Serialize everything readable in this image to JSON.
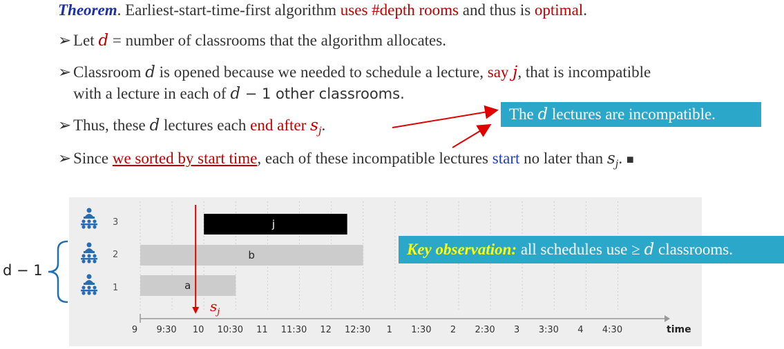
{
  "theorem": {
    "label": "Theorem",
    "text_1": ". Earliest-start-time-first algorithm ",
    "red_1": "uses #depth rooms",
    "text_2": " and thus is ",
    "red_2": "optimal",
    "text_3": "."
  },
  "bullets": {
    "b1_pre": "Let ",
    "b1_var": "d",
    "b1_post": " = number of classrooms that the algorithm allocates.",
    "b2_pre": "Classroom ",
    "b2_var": "d",
    "b2_mid": " is opened because we needed to schedule a lecture, ",
    "b2_red": "say ",
    "b2_redvar": "j",
    "b2_post": ", that is incompatible",
    "b2_line2_pre": "with a lecture in each of ",
    "b2_line2_var": "d",
    "b2_line2_post": " − 1 other classrooms.",
    "b3_pre": "Thus, these ",
    "b3_var": "d",
    "b3_mid": " lectures each ",
    "b3_red": "end after ",
    "b3_redvar": "s",
    "b3_sub": "j",
    "b3_post": ".",
    "b4_pre": "Since ",
    "b4_link": "we sorted by start time",
    "b4_mid": ", each of these incompatible lectures ",
    "b4_blue": "start",
    "b4_post": " no later than ",
    "b4_var": "s",
    "b4_sub": "j",
    "b4_end": ".",
    "qed": "■"
  },
  "callout_top": {
    "pre": "The ",
    "var": "d",
    "post": " lectures are incompatible."
  },
  "callout_key": {
    "label": "Key observation:",
    "text": " all schedules use ≥ ",
    "var": "d",
    "post": " classrooms."
  },
  "brace_label": "d − 1",
  "chart_data": {
    "type": "gantt",
    "x_label": "time",
    "x_ticks": [
      "9",
      "9:30",
      "10",
      "10:30",
      "11",
      "11:30",
      "12",
      "12:30",
      "1",
      "1:30",
      "2",
      "2:30",
      "3",
      "3:30",
      "4",
      "4:30"
    ],
    "rooms": [
      {
        "number": "1",
        "lectures": [
          {
            "name": "a",
            "start": 9.0,
            "end": 10.5,
            "color": "#cccccc"
          }
        ]
      },
      {
        "number": "2",
        "lectures": [
          {
            "name": "b",
            "start": 9.0,
            "end": 12.5,
            "color": "#cccccc"
          }
        ]
      },
      {
        "number": "3",
        "lectures": [
          {
            "name": "j",
            "start": 10.0,
            "end": 12.25,
            "color": "#000000"
          }
        ]
      }
    ],
    "marker": {
      "label": "s",
      "sub": "j",
      "time": 10.0,
      "color": "#e00000"
    }
  },
  "colors": {
    "accent_red": "#c00000",
    "callout_bg": "#2aa7c9",
    "key_label": "#ffff00",
    "brace": "#1f6fb5"
  }
}
